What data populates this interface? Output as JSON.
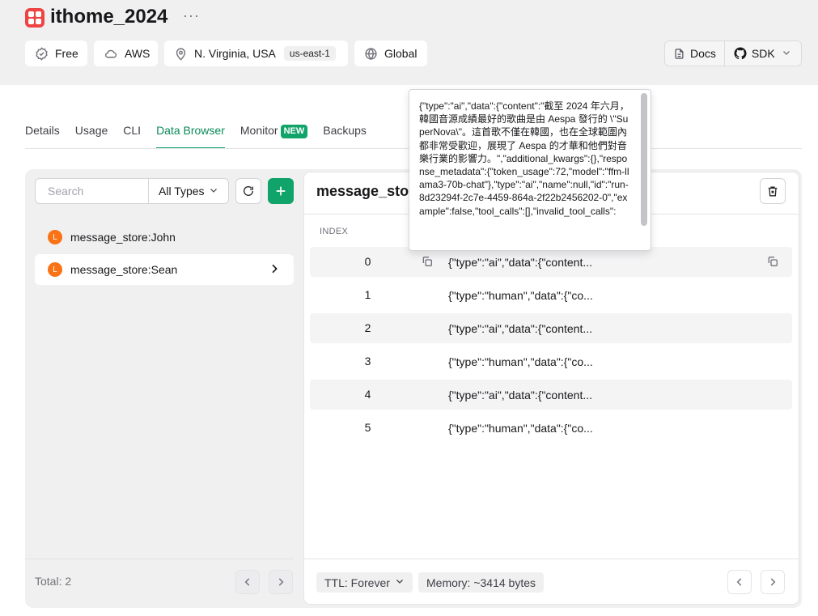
{
  "header": {
    "db_name": "ithome_2024",
    "more_symbol": "···",
    "chips": {
      "plan": "Free",
      "provider": "AWS",
      "region": "N. Virginia, USA",
      "region_code": "us-east-1",
      "scope": "Global"
    },
    "docs_label": "Docs",
    "sdk_label": "SDK"
  },
  "tabs": [
    {
      "label": "Details"
    },
    {
      "label": "Usage"
    },
    {
      "label": "CLI"
    },
    {
      "label": "Data Browser",
      "active": true
    },
    {
      "label": "Monitor",
      "badge": "NEW"
    },
    {
      "label": "Backups"
    }
  ],
  "left_panel": {
    "search_placeholder": "Search",
    "type_filter": "All Types",
    "keys": [
      {
        "badge": "L",
        "name": "message_store:John"
      },
      {
        "badge": "L",
        "name": "message_store:Sean",
        "selected": true
      }
    ],
    "total_label": "Total: 2"
  },
  "right_panel": {
    "title": "message_store:Sean",
    "index_header": "INDEX",
    "rows": [
      {
        "index": "0",
        "value": "{\"type\":\"ai\",\"data\":{\"content..."
      },
      {
        "index": "1",
        "value": "{\"type\":\"human\",\"data\":{\"co..."
      },
      {
        "index": "2",
        "value": "{\"type\":\"ai\",\"data\":{\"content..."
      },
      {
        "index": "3",
        "value": "{\"type\":\"human\",\"data\":{\"co..."
      },
      {
        "index": "4",
        "value": "{\"type\":\"ai\",\"data\":{\"content..."
      },
      {
        "index": "5",
        "value": "{\"type\":\"human\",\"data\":{\"co..."
      }
    ],
    "ttl_label": "TTL:",
    "ttl_value": "Forever",
    "memory_label": "Memory: ~3414 bytes"
  },
  "tooltip": {
    "text": "{\"type\":\"ai\",\"data\":{\"content\":\"截至 2024 年六月，韓國音源成績最好的歌曲是由 Aespa 發行的 \\\"SuperNova\\\"。這首歌不僅在韓國，也在全球範圍內都非常受歡迎，展現了 Aespa 的才華和他們對音樂行業的影響力。\",\"additional_kwargs\":{},\"response_metadata\":{\"token_usage\":72,\"model\":\"ffm-llama3-70b-chat\"},\"type\":\"ai\",\"name\":null,\"id\":\"run-8d23294f-2c7e-4459-864a-2f22b2456202-0\",\"example\":false,\"tool_calls\":[],\"invalid_tool_calls\":"
  },
  "colors": {
    "accent": "#10a36a",
    "brand": "#ef4444",
    "key_badge": "#f97316"
  }
}
